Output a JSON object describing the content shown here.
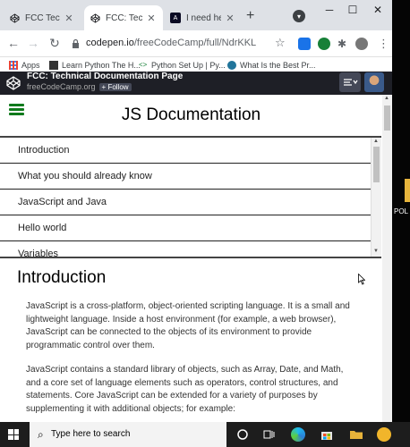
{
  "browser": {
    "tabs": [
      {
        "title": "FCC Tech Do",
        "active": false
      },
      {
        "title": "FCC: Technic",
        "active": true
      },
      {
        "title": "I need help w",
        "active": false
      }
    ],
    "new_tab_symbol": "+",
    "url_domain": "codepen.io",
    "url_path": "/freeCodeCamp/full/NdrKKL",
    "bookmarks": [
      {
        "label": "Apps",
        "icon": "apps-grid-icon"
      },
      {
        "label": "Learn Python The H...",
        "icon": "bookmark-l-icon"
      },
      {
        "label": "Python Set Up | Py...",
        "icon": "bookmark-code-icon"
      },
      {
        "label": "What Is the Best Pr...",
        "icon": "wordpress-icon"
      }
    ]
  },
  "codepen": {
    "title": "FCC: Technical Documentation Page",
    "author": "freeCodeCamp.org",
    "follow_label": "+ Follow"
  },
  "page": {
    "title": "JS Documentation",
    "nav_items": [
      "Introduction",
      "What you should already know",
      "JavaScript and Java",
      "Hello world",
      "Variables"
    ],
    "section": {
      "title": "Introduction",
      "paragraphs": [
        "JavaScript is a cross-platform, object-oriented scripting language. It is a small and lightweight language. Inside a host environment (for example, a web browser), JavaScript can be connected to the objects of its environment to provide programmatic control over them.",
        "JavaScript contains a standard library of objects, such as Array, Date, and Math, and a core set of language elements such as operators, control structures, and statements. Core JavaScript can be extended for a variety of purposes by supplementing it with additional objects; for example:"
      ]
    }
  },
  "taskbar": {
    "search_placeholder": "Type here to search"
  },
  "desktop": {
    "icon_label": "POL S"
  },
  "colors": {
    "codepen_bar": "#1e1f26",
    "hamburger_green": "#0f7a1c",
    "tab_strip": "#dee1e6"
  }
}
